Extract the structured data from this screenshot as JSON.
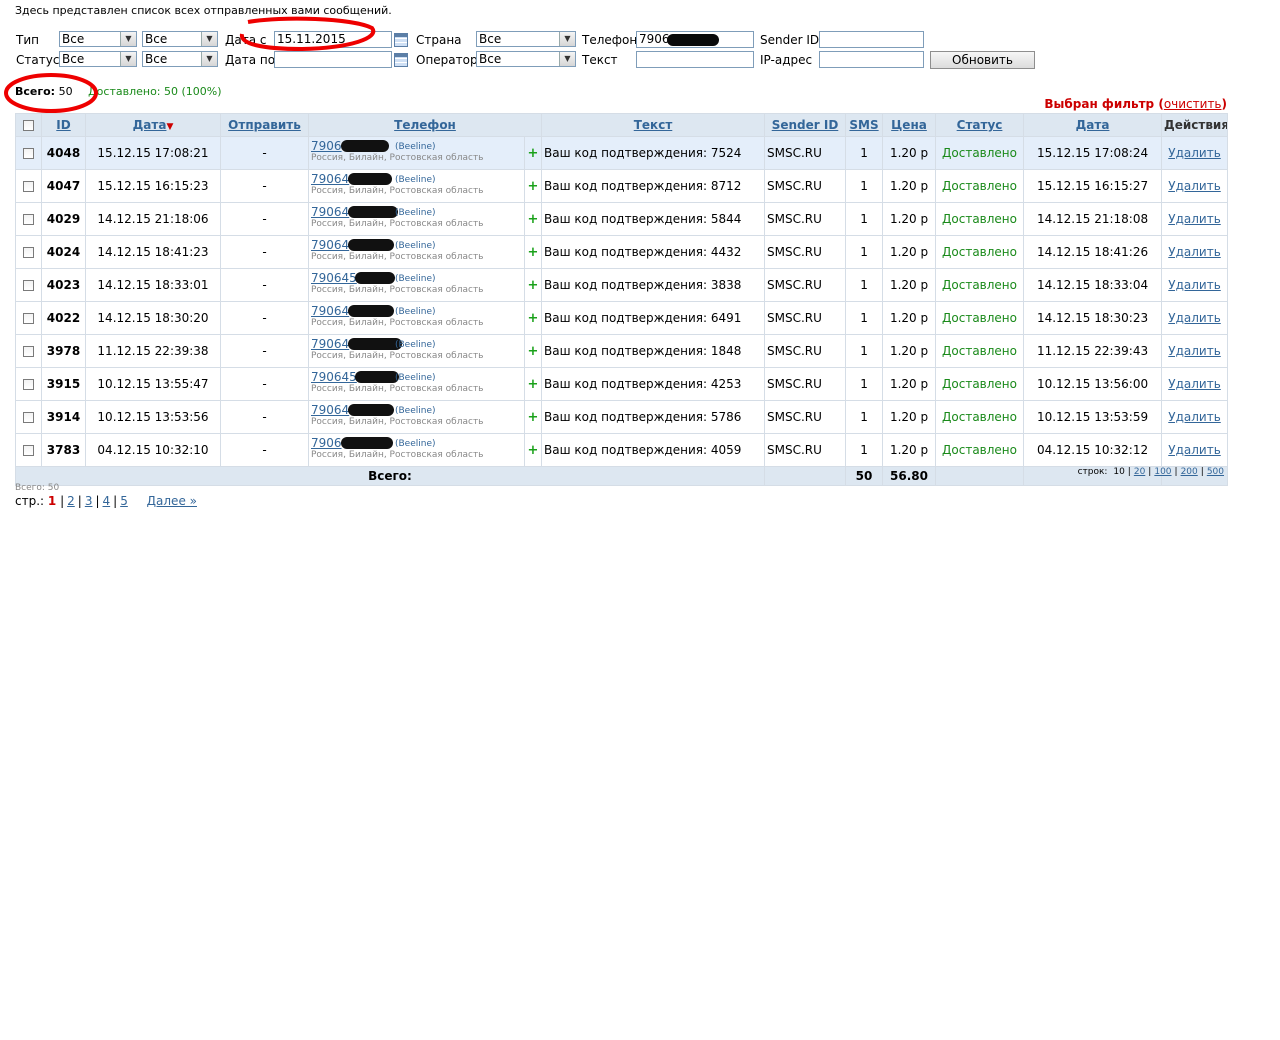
{
  "intro": "Здесь представлен список всех отправленных вами сообщений.",
  "filters": {
    "type_label": "Тип",
    "type_value": "Все",
    "type_value2": "Все",
    "status_label": "Статус",
    "status_value": "Все",
    "status_value2": "Все",
    "date_from_label": "Дата с",
    "date_from_value": "15.11.2015",
    "date_to_label": "Дата по",
    "date_to_value": "",
    "country_label": "Страна",
    "country_value": "Все",
    "operator_label": "Оператор",
    "operator_value": "Все",
    "phone_label": "Телефон",
    "phone_value": "7906",
    "text_label": "Текст",
    "text_value": "",
    "sender_label": "Sender ID",
    "sender_value": "",
    "ip_label": "IP-адрес",
    "ip_value": "",
    "refresh_label": "Обновить"
  },
  "stats": {
    "total_label": "Всего:",
    "total_value": "50",
    "delivered_label": "Доставлено:",
    "delivered_value": "50 (100%)"
  },
  "filter_notice": {
    "label": "Выбран фильтр",
    "clear_label": "очистить"
  },
  "columns": {
    "id": "ID",
    "date": "Дата",
    "sort_marker": "▼",
    "send": "Отправить",
    "phone": "Телефон",
    "text": "Текст",
    "sender": "Sender ID",
    "sms": "SMS",
    "price": "Цена",
    "status": "Статус",
    "date2": "Дата",
    "actions": "Действия"
  },
  "rows": [
    {
      "id": "4048",
      "date": "15.12.15 17:08:21",
      "send": "-",
      "phone": "7906",
      "operator": "(Beeline)",
      "region": "Россия, Билайн, Ростовская область",
      "plus": "+",
      "text": "Ваш код подтверждения: 7524",
      "sender": "SMSC.RU",
      "sms": "1",
      "price": "1.20 р",
      "status": "Доставлено",
      "date2": "15.12.15 17:08:24",
      "action": "Удалить"
    },
    {
      "id": "4047",
      "date": "15.12.15 16:15:23",
      "send": "-",
      "phone": "79064",
      "operator": "(Beeline)",
      "region": "Россия, Билайн, Ростовская область",
      "plus": "+",
      "text": "Ваш код подтверждения: 8712",
      "sender": "SMSC.RU",
      "sms": "1",
      "price": "1.20 р",
      "status": "Доставлено",
      "date2": "15.12.15 16:15:27",
      "action": "Удалить"
    },
    {
      "id": "4029",
      "date": "14.12.15 21:18:06",
      "send": "-",
      "phone": "79064",
      "operator": "(Beeline)",
      "region": "Россия, Билайн, Ростовская область",
      "plus": "+",
      "text": "Ваш код подтверждения: 5844",
      "sender": "SMSC.RU",
      "sms": "1",
      "price": "1.20 р",
      "status": "Доставлено",
      "date2": "14.12.15 21:18:08",
      "action": "Удалить"
    },
    {
      "id": "4024",
      "date": "14.12.15 18:41:23",
      "send": "-",
      "phone": "79064",
      "operator": "(Beeline)",
      "region": "Россия, Билайн, Ростовская область",
      "plus": "+",
      "text": "Ваш код подтверждения: 4432",
      "sender": "SMSC.RU",
      "sms": "1",
      "price": "1.20 р",
      "status": "Доставлено",
      "date2": "14.12.15 18:41:26",
      "action": "Удалить"
    },
    {
      "id": "4023",
      "date": "14.12.15 18:33:01",
      "send": "-",
      "phone": "790645",
      "operator": "(Beeline)",
      "region": "Россия, Билайн, Ростовская область",
      "plus": "+",
      "text": "Ваш код подтверждения: 3838",
      "sender": "SMSC.RU",
      "sms": "1",
      "price": "1.20 р",
      "status": "Доставлено",
      "date2": "14.12.15 18:33:04",
      "action": "Удалить"
    },
    {
      "id": "4022",
      "date": "14.12.15 18:30:20",
      "send": "-",
      "phone": "79064",
      "operator": "(Beeline)",
      "region": "Россия, Билайн, Ростовская область",
      "plus": "+",
      "text": "Ваш код подтверждения: 6491",
      "sender": "SMSC.RU",
      "sms": "1",
      "price": "1.20 р",
      "status": "Доставлено",
      "date2": "14.12.15 18:30:23",
      "action": "Удалить"
    },
    {
      "id": "3978",
      "date": "11.12.15 22:39:38",
      "send": "-",
      "phone": "79064",
      "operator": "(Beeline)",
      "region": "Россия, Билайн, Ростовская область",
      "plus": "+",
      "text": "Ваш код подтверждения: 1848",
      "sender": "SMSC.RU",
      "sms": "1",
      "price": "1.20 р",
      "status": "Доставлено",
      "date2": "11.12.15 22:39:43",
      "action": "Удалить"
    },
    {
      "id": "3915",
      "date": "10.12.15 13:55:47",
      "send": "-",
      "phone": "790645",
      "operator": "(Beeline)",
      "region": "Россия, Билайн, Ростовская область",
      "plus": "+",
      "text": "Ваш код подтверждения: 4253",
      "sender": "SMSC.RU",
      "sms": "1",
      "price": "1.20 р",
      "status": "Доставлено",
      "date2": "10.12.15 13:56:00",
      "action": "Удалить"
    },
    {
      "id": "3914",
      "date": "10.12.15 13:53:56",
      "send": "-",
      "phone": "79064",
      "operator": "(Beeline)",
      "region": "Россия, Билайн, Ростовская область",
      "plus": "+",
      "text": "Ваш код подтверждения: 5786",
      "sender": "SMSC.RU",
      "sms": "1",
      "price": "1.20 р",
      "status": "Доставлено",
      "date2": "10.12.15 13:53:59",
      "action": "Удалить"
    },
    {
      "id": "3783",
      "date": "04.12.15 10:32:10",
      "send": "-",
      "phone": "7906",
      "operator": "(Beeline)",
      "region": "Россия, Билайн, Ростовская область",
      "plus": "+",
      "text": "Ваш код подтверждения: 4059",
      "sender": "SMSC.RU",
      "sms": "1",
      "price": "1.20 р",
      "status": "Доставлено",
      "date2": "04.12.15 10:32:12",
      "action": "Удалить"
    }
  ],
  "footer": {
    "total_label": "Всего:",
    "sms_total": "50",
    "price_total": "56.80"
  },
  "rows_per_page": {
    "label": "строк:",
    "options": [
      "10",
      "20",
      "100",
      "200",
      "500"
    ]
  },
  "pagination": {
    "total_small": "Всего: 50",
    "label": "стр.:",
    "current": "1",
    "pages": [
      "2",
      "3",
      "4",
      "5"
    ],
    "next": "Далее »"
  },
  "colors": {
    "link": "#336699",
    "header_bg": "#dde7f1",
    "delivered": "#1a8a1a",
    "alert": "#cc0000",
    "annotation": "#ee0000"
  }
}
